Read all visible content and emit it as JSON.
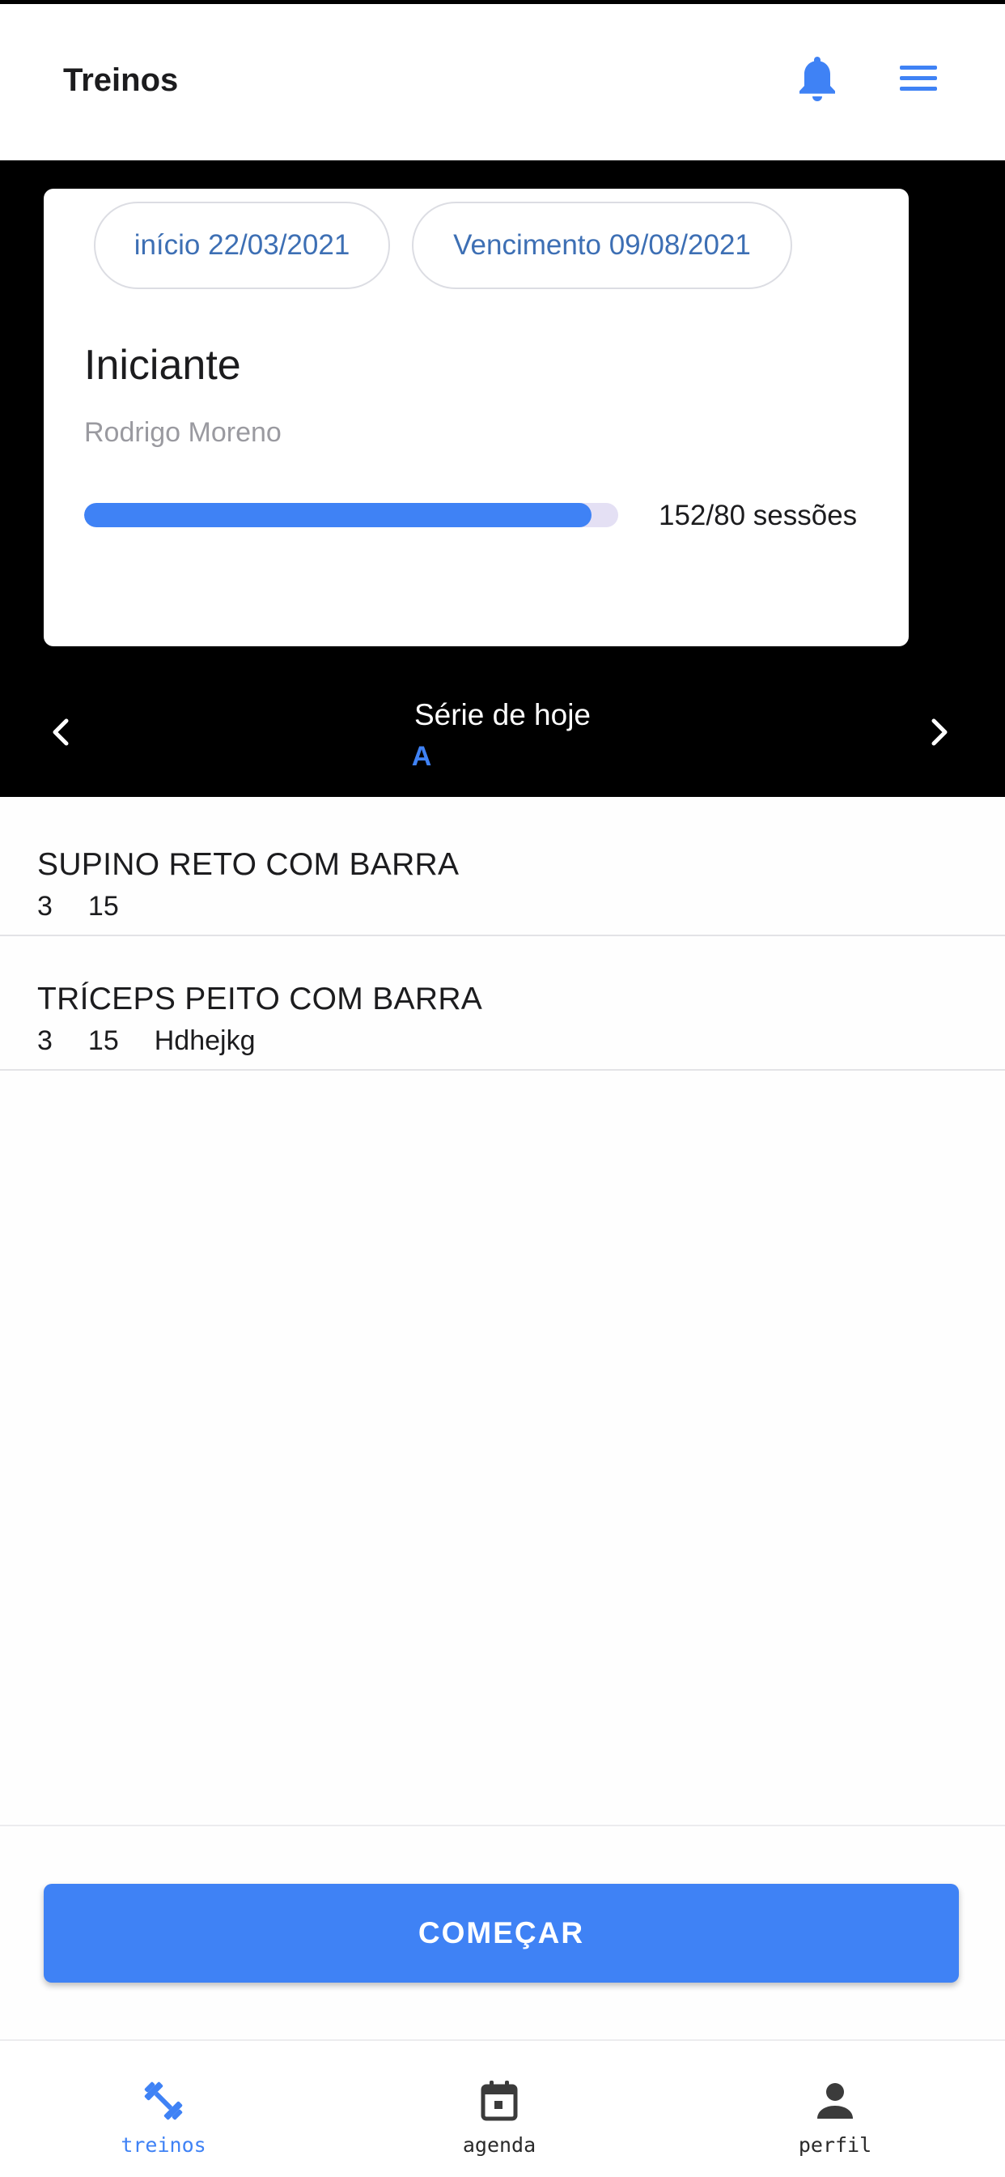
{
  "app_bar": {
    "title": "Treinos",
    "icons": [
      "bell-icon",
      "menu-icon"
    ]
  },
  "plan": {
    "start_date": "início 22/03/2021",
    "due_date": "Vencimento 09/08/2021",
    "level": "Iniciante",
    "trainer": "Rodrigo Moreno",
    "progress_text": "152/80 sessões",
    "progress_fraction": 0.95
  },
  "series": {
    "label": "Série de hoje",
    "letter": "A"
  },
  "exercises": [
    {
      "name": "SUPINO RETO COM BARRA",
      "sets": "3",
      "reps": "15",
      "note": ""
    },
    {
      "name": "TRÍCEPS PEITO COM BARRA",
      "sets": "3",
      "reps": "15",
      "note": "Hdhejkg"
    }
  ],
  "action": {
    "start_label": "COMEÇAR"
  },
  "bottom_nav": {
    "items": [
      {
        "label": "treinos",
        "icon": "dumbbell-icon",
        "active": true
      },
      {
        "label": "agenda",
        "icon": "calendar-icon",
        "active": false
      },
      {
        "label": "perfil",
        "icon": "person-icon",
        "active": false
      }
    ]
  },
  "colors": {
    "accent": "#3f82f5",
    "chip_text": "#3d6fb4",
    "header_background": "#000000"
  }
}
